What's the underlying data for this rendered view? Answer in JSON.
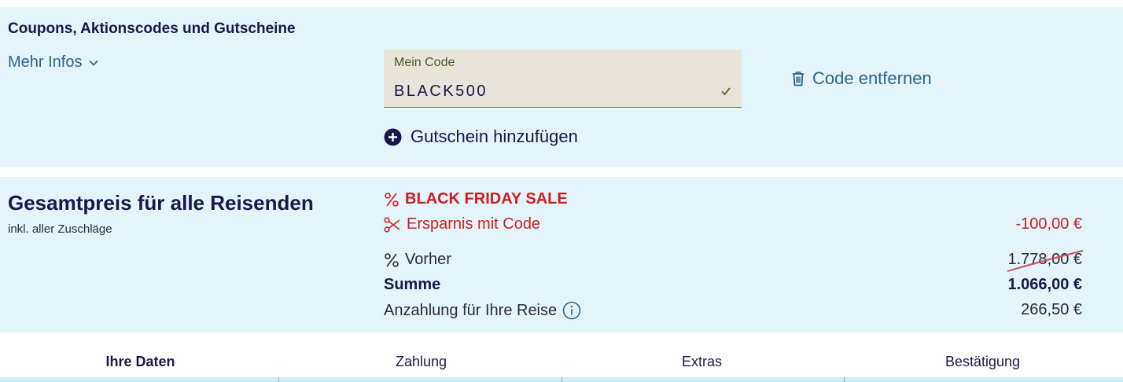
{
  "coupon": {
    "title": "Coupons, Aktionscodes und Gutscheine",
    "more_info_label": "Mehr Infos",
    "code_field": {
      "label": "Mein Code",
      "value": "BLACK500",
      "valid": true
    },
    "remove_code_label": "Code entfernen",
    "add_voucher_label": "Gutschein hinzufügen"
  },
  "total": {
    "title": "Gesamtpreis für alle Reisenden",
    "subtitle": "inkl. aller Zuschläge",
    "sale_label": "BLACK FRIDAY SALE",
    "savings_label": "Ersparnis mit Code",
    "savings_amount": "-100,00 €",
    "before_label": "Vorher",
    "before_amount": "1.778,00 €",
    "sum_label": "Summe",
    "sum_amount": "1.066,00 €",
    "deposit_label": "Anzahlung für Ihre Reise",
    "deposit_amount": "266,50 €"
  },
  "steps": [
    {
      "label": "Ihre Daten",
      "active": true
    },
    {
      "label": "Zahlung",
      "active": false
    },
    {
      "label": "Extras",
      "active": false
    },
    {
      "label": "Bestätigung",
      "active": false
    }
  ],
  "colors": {
    "panel_bg": "#e3f4fb",
    "navy": "#1a1848",
    "link_blue": "#2d6589",
    "sale_red": "#cc1f22",
    "field_bg": "#e8e3db"
  },
  "icons": {
    "more_info": "chevron-down-icon",
    "code_valid": "check-icon",
    "remove_code": "trash-icon",
    "add_voucher": "plus-circle-icon",
    "sale": "percent-icon",
    "savings": "scissors-icon",
    "before": "percent-icon",
    "deposit": "info-icon"
  }
}
